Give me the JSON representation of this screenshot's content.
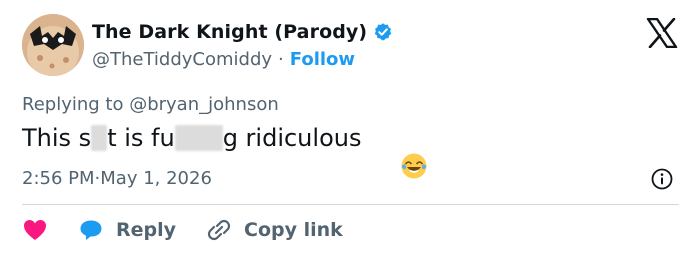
{
  "author": {
    "display_name": "The Dark Knight (Parody)",
    "handle": "@TheTiddyComiddy",
    "separator": "·",
    "follow_label": "Follow",
    "verified_color": "#1d9bf0"
  },
  "reply": {
    "prefix": "Replying to ",
    "handle": "@bryan_johnson"
  },
  "tweet": {
    "part1": "This s",
    "part2": "t is fu",
    "part3": "g ridiculous",
    "emoji_icon": "face-with-tears-of-joy-icon"
  },
  "meta": {
    "time": "2:56 PM",
    "separator": " · ",
    "date": "May 1, 2026"
  },
  "actions": {
    "like_icon": "heart-icon",
    "like_color": "#f91880",
    "reply_label": "Reply",
    "reply_color": "#1d9bf0",
    "copy_label": "Copy link"
  },
  "colors": {
    "text": "#0f1419",
    "secondary": "#536471",
    "accent": "#1d9bf0"
  }
}
